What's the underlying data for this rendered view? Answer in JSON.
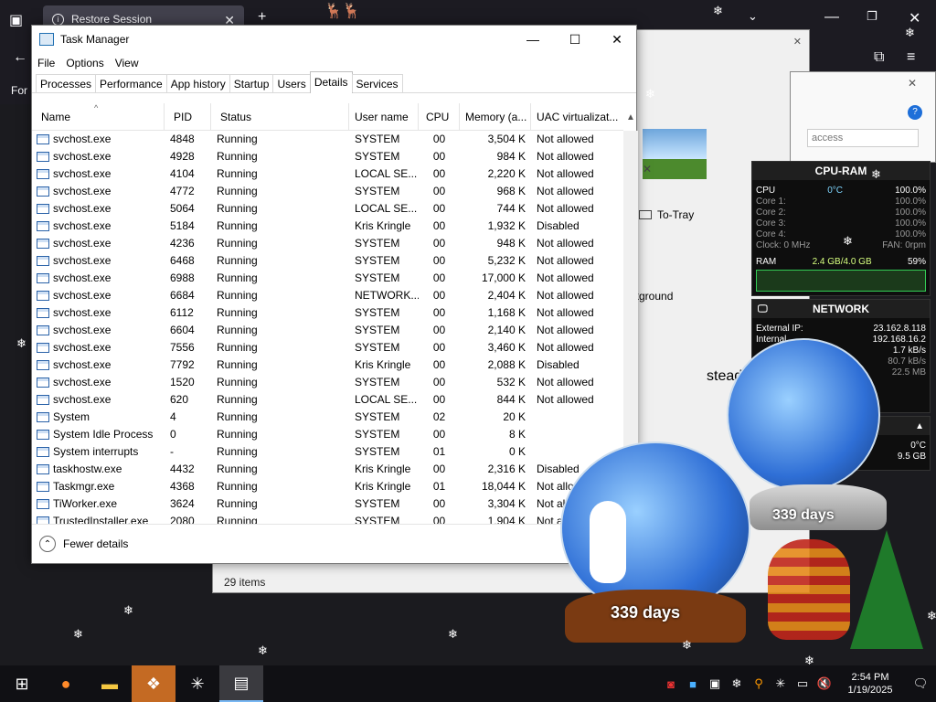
{
  "browser": {
    "tab_title": "Restore Session",
    "sidebar_text": "For"
  },
  "task_manager": {
    "title": "Task Manager",
    "menu": [
      "File",
      "Options",
      "View"
    ],
    "tabs": [
      "Processes",
      "Performance",
      "App history",
      "Startup",
      "Users",
      "Details",
      "Services"
    ],
    "active_tab": "Details",
    "columns": [
      "Name",
      "PID",
      "Status",
      "User name",
      "CPU",
      "Memory (a...",
      "UAC virtualizat..."
    ],
    "rows": [
      [
        "svchost.exe",
        "4848",
        "Running",
        "SYSTEM",
        "00",
        "3,504 K",
        "Not allowed"
      ],
      [
        "svchost.exe",
        "4928",
        "Running",
        "SYSTEM",
        "00",
        "984 K",
        "Not allowed"
      ],
      [
        "svchost.exe",
        "4104",
        "Running",
        "LOCAL SE...",
        "00",
        "2,220 K",
        "Not allowed"
      ],
      [
        "svchost.exe",
        "4772",
        "Running",
        "SYSTEM",
        "00",
        "968 K",
        "Not allowed"
      ],
      [
        "svchost.exe",
        "5064",
        "Running",
        "LOCAL SE...",
        "00",
        "744 K",
        "Not allowed"
      ],
      [
        "svchost.exe",
        "5184",
        "Running",
        "Kris Kringle",
        "00",
        "1,932 K",
        "Disabled"
      ],
      [
        "svchost.exe",
        "4236",
        "Running",
        "SYSTEM",
        "00",
        "948 K",
        "Not allowed"
      ],
      [
        "svchost.exe",
        "6468",
        "Running",
        "SYSTEM",
        "00",
        "5,232 K",
        "Not allowed"
      ],
      [
        "svchost.exe",
        "6988",
        "Running",
        "SYSTEM",
        "00",
        "17,000 K",
        "Not allowed"
      ],
      [
        "svchost.exe",
        "6684",
        "Running",
        "NETWORK...",
        "00",
        "2,404 K",
        "Not allowed"
      ],
      [
        "svchost.exe",
        "6112",
        "Running",
        "SYSTEM",
        "00",
        "1,168 K",
        "Not allowed"
      ],
      [
        "svchost.exe",
        "6604",
        "Running",
        "SYSTEM",
        "00",
        "2,140 K",
        "Not allowed"
      ],
      [
        "svchost.exe",
        "7556",
        "Running",
        "SYSTEM",
        "00",
        "3,460 K",
        "Not allowed"
      ],
      [
        "svchost.exe",
        "7792",
        "Running",
        "Kris Kringle",
        "00",
        "2,088 K",
        "Disabled"
      ],
      [
        "svchost.exe",
        "1520",
        "Running",
        "SYSTEM",
        "00",
        "532 K",
        "Not allowed"
      ],
      [
        "svchost.exe",
        "620",
        "Running",
        "LOCAL SE...",
        "00",
        "844 K",
        "Not allowed"
      ],
      [
        "System",
        "4",
        "Running",
        "SYSTEM",
        "02",
        "20 K",
        ""
      ],
      [
        "System Idle Process",
        "0",
        "Running",
        "SYSTEM",
        "00",
        "8 K",
        ""
      ],
      [
        "System interrupts",
        "-",
        "Running",
        "SYSTEM",
        "01",
        "0 K",
        ""
      ],
      [
        "taskhostw.exe",
        "4432",
        "Running",
        "Kris Kringle",
        "00",
        "2,316 K",
        "Disabled"
      ],
      [
        "Taskmgr.exe",
        "4368",
        "Running",
        "Kris Kringle",
        "01",
        "18,044 K",
        "Not allo..."
      ],
      [
        "TiWorker.exe",
        "3624",
        "Running",
        "SYSTEM",
        "00",
        "3,304 K",
        "Not all..."
      ],
      [
        "TrustedInstaller.exe",
        "2080",
        "Running",
        "SYSTEM",
        "00",
        "1,904 K",
        "Not al..."
      ]
    ],
    "fewer_details": "Fewer details"
  },
  "background_window": {
    "status_items": "29 items",
    "search_placeholder": "access",
    "to_tray": "To-Tray",
    "kground_text": "kground",
    "instead_text": "stead"
  },
  "gadget_cpu": {
    "title": "CPU-RAM",
    "cpu_label": "CPU",
    "cpu_temp": "0°C",
    "cpu_total": "100.0%",
    "cores": [
      {
        "label": "Core 1:",
        "value": "100.0%"
      },
      {
        "label": "Core 2:",
        "value": "100.0%"
      },
      {
        "label": "Core 3:",
        "value": "100.0%"
      },
      {
        "label": "Core 4:",
        "value": "100.0%"
      }
    ],
    "clock": "Clock: 0 MHz",
    "fan": "FAN: 0rpm",
    "ram_label": "RAM",
    "ram_value": "2.4 GB/4.0 GB",
    "ram_percent": "59%"
  },
  "gadget_network": {
    "title": "NETWORK",
    "external_ip_label": "External IP:",
    "external_ip": "23.162.8.118",
    "internal_ip_label": "Internal",
    "internal_ip": "192.168.16.2",
    "speed1": "1.7 kB/s",
    "speed2": "80.7 kB/s",
    "total": "22.5 MB"
  },
  "gadget_misc": {
    "temp": "0°C",
    "size": "9.5 GB"
  },
  "snow_globes": {
    "left_label": "339 days",
    "right_label": "339 days"
  },
  "taskbar": {
    "time": "2:54 PM",
    "date": "1/19/2025"
  }
}
